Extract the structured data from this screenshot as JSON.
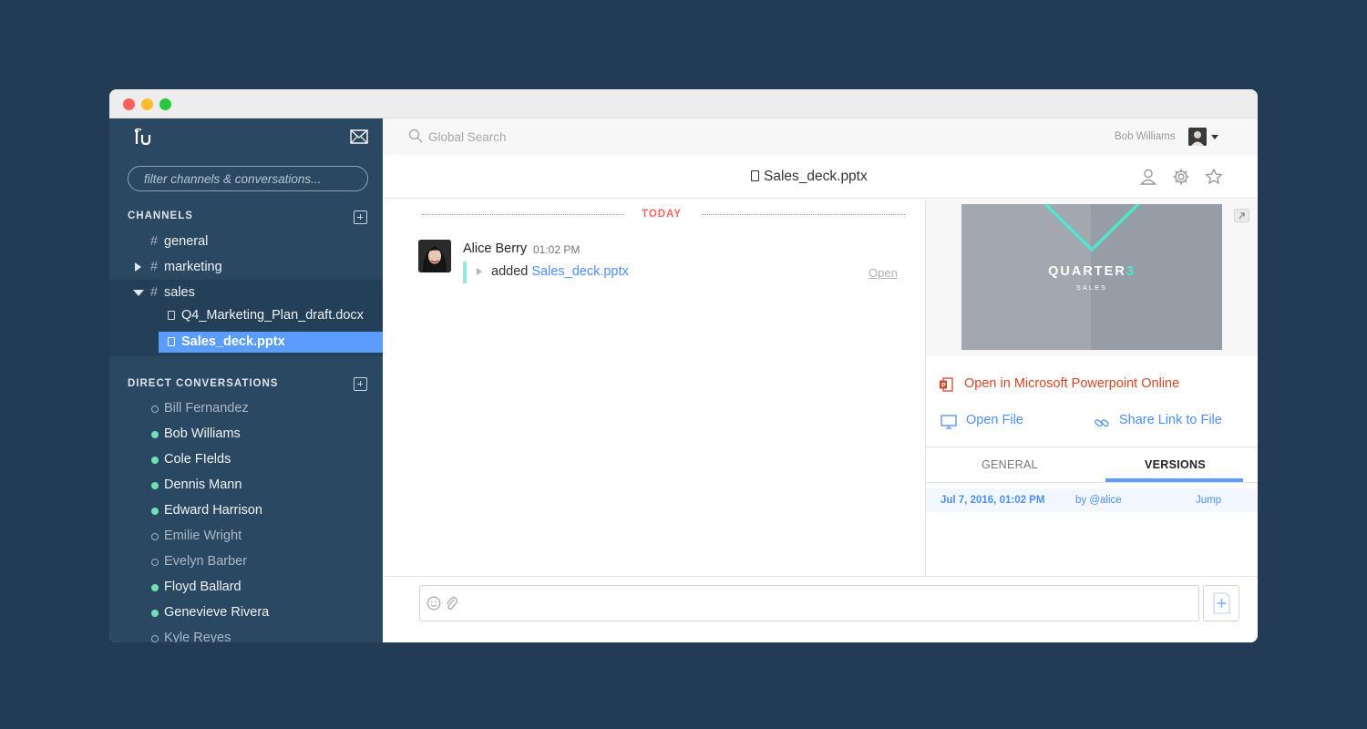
{
  "sidebar": {
    "filter_placeholder": "filter channels & conversations...",
    "channels_heading": "CHANNELS",
    "channels": [
      {
        "name": "general"
      },
      {
        "name": "marketing"
      },
      {
        "name": "sales",
        "files": [
          "Q4_Marketing_Plan_draft.docx",
          "Sales_deck.pptx"
        ]
      }
    ],
    "dm_heading": "DIRECT CONVERSATIONS",
    "direct": [
      {
        "name": "Bill Fernandez",
        "online": false
      },
      {
        "name": "Bob Williams",
        "online": true
      },
      {
        "name": "Cole FIelds",
        "online": true
      },
      {
        "name": "Dennis Mann",
        "online": true
      },
      {
        "name": "Edward Harrison",
        "online": true
      },
      {
        "name": "Emilie Wright",
        "online": false
      },
      {
        "name": "Evelyn Barber",
        "online": false
      },
      {
        "name": "Floyd Ballard",
        "online": true
      },
      {
        "name": "Genevieve Rivera",
        "online": true
      },
      {
        "name": "Kyle Reyes",
        "online": false
      }
    ]
  },
  "topbar": {
    "search_placeholder": "Global Search",
    "user_name": "Bob Williams"
  },
  "header": {
    "title": "Sales_deck.pptx"
  },
  "chat": {
    "divider": "TODAY",
    "message": {
      "author": "Alice Berry",
      "time": "01:02 PM",
      "verb": "added",
      "file": "Sales_deck.pptx",
      "open_label": "Open"
    }
  },
  "panel": {
    "slide_title_main": "QUARTER",
    "slide_title_accent": "3",
    "slide_subtitle": "SALES",
    "open_in_ppt": "Open in Microsoft Powerpoint Online",
    "open_file": "Open File",
    "share_link": "Share Link to File",
    "tabs": {
      "general": "GENERAL",
      "versions": "VERSIONS"
    },
    "versions": [
      {
        "date": "Jul 7, 2016, 01:02 PM",
        "by": "by @alice",
        "action": "Jump"
      }
    ]
  },
  "colors": {
    "sidebar": "#2b4863",
    "active": "#5b9dff",
    "online": "#6ee0b4",
    "link": "#4c8ff2",
    "ppt": "#d24726",
    "accent_teal": "#4fe6cc"
  },
  "icons": [
    "logo-icon",
    "compose-mail-icon",
    "search-icon",
    "user-icon",
    "gear-icon",
    "star-icon",
    "expand-icon",
    "powerpoint-icon",
    "monitor-icon",
    "link-icon",
    "emoji-icon",
    "paperclip-icon",
    "upload-icon"
  ]
}
